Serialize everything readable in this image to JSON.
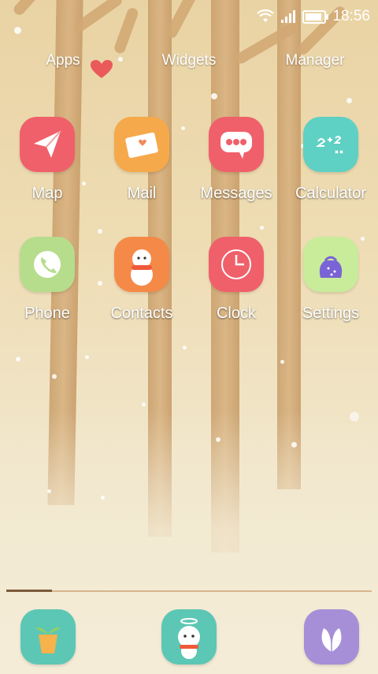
{
  "status_bar": {
    "time": "18:56",
    "battery_level_percent": 90
  },
  "top_nav": {
    "apps": "Apps",
    "widgets": "Widgets",
    "manager": "Manager"
  },
  "apps": [
    {
      "label": "Map",
      "icon": "paper-plane-icon",
      "color": "#f0606a"
    },
    {
      "label": "Mail",
      "icon": "envelope-heart-icon",
      "color": "#f6a94b"
    },
    {
      "label": "Messages",
      "icon": "chat-bubble-icon",
      "color": "#f0606a"
    },
    {
      "label": "Calculator",
      "icon": "chalkboard-icon",
      "color": "#5fd0c4"
    },
    {
      "label": "Phone",
      "icon": "phone-icon",
      "color": "#b6dd8c"
    },
    {
      "label": "Contacts",
      "icon": "snowman-icon",
      "color": "#f58a48"
    },
    {
      "label": "Clock",
      "icon": "clock-icon",
      "color": "#f0606a"
    },
    {
      "label": "Settings",
      "icon": "gift-bag-icon",
      "color": "#c8ec9a"
    }
  ],
  "dock": [
    {
      "icon": "plant-pot-icon",
      "color": "#5cc7b4"
    },
    {
      "icon": "angel-snowman-icon",
      "color": "#5cc7b4"
    },
    {
      "icon": "leaf-icon",
      "color": "#a78fd8"
    }
  ],
  "page_indicator": {
    "current_page": 1,
    "total_pages": 8
  }
}
